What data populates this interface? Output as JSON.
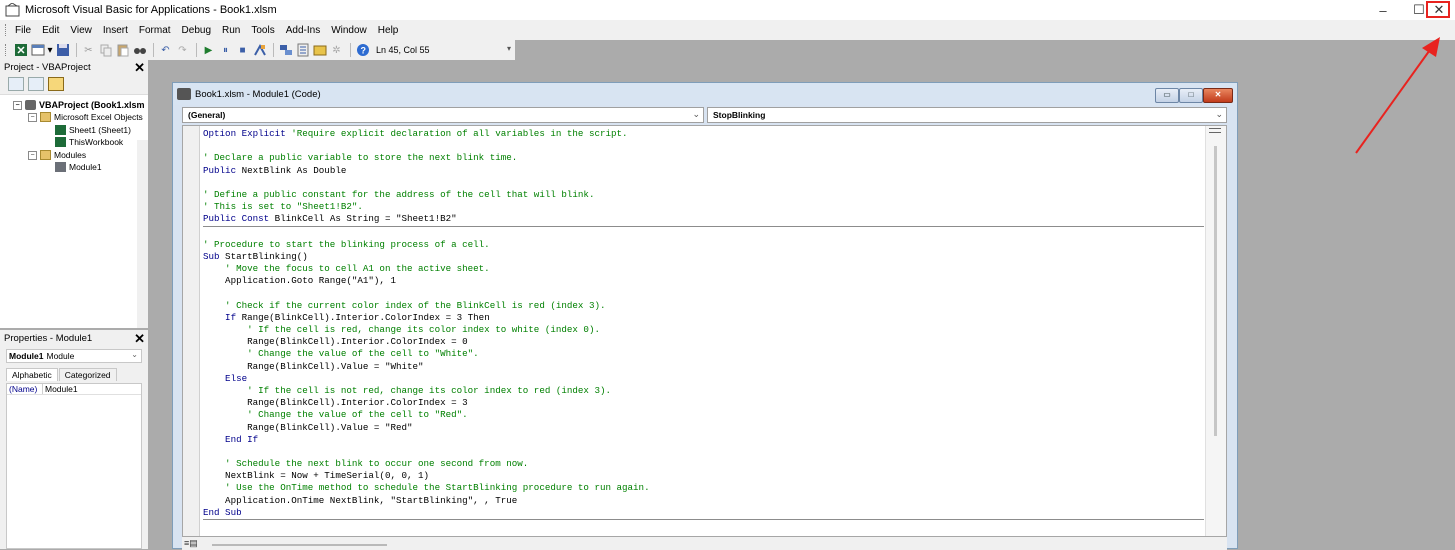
{
  "window": {
    "title": "Microsoft Visual Basic for Applications - Book1.xlsm",
    "minimize": "–",
    "maximize": "☐",
    "close": "✕"
  },
  "menu": {
    "items": [
      "File",
      "Edit",
      "View",
      "Insert",
      "Format",
      "Debug",
      "Run",
      "Tools",
      "Add-Ins",
      "Window",
      "Help"
    ]
  },
  "toolbar": {
    "position": "Ln 45, Col 55"
  },
  "project": {
    "title": "Project - VBAProject",
    "tree": {
      "root": "VBAProject (Book1.xlsm",
      "objects_folder": "Microsoft Excel Objects",
      "sheet1": "Sheet1 (Sheet1)",
      "workbook": "ThisWorkbook",
      "modules_folder": "Modules",
      "module1": "Module1"
    }
  },
  "properties": {
    "title": "Properties - Module1",
    "object_name": "Module1",
    "object_type": "Module",
    "tab_alphabetic": "Alphabetic",
    "tab_categorized": "Categorized",
    "prop_key": "(Name)",
    "prop_value": "Module1"
  },
  "code_window": {
    "title": "Book1.xlsm - Module1 (Code)",
    "object_combo": "(General)",
    "proc_combo": "StopBlinking",
    "btn_min": "▭",
    "btn_max": "□",
    "btn_close": "✕",
    "view_buttons": "≡▤",
    "lines": [
      {
        "kw": "Option Explicit",
        "cm": " 'Require explicit declaration of all variables in the script.",
        "tx": ""
      },
      {
        "kw": "",
        "cm": "",
        "tx": ""
      },
      {
        "kw": "",
        "cm": "' Declare a public variable to store the next blink time.",
        "tx": ""
      },
      {
        "kw": "Public",
        "cm": "",
        "tx": " NextBlink As Double"
      },
      {
        "kw": "",
        "cm": "",
        "tx": ""
      },
      {
        "kw": "",
        "cm": "' Define a public constant for the address of the cell that will blink.",
        "tx": ""
      },
      {
        "kw": "",
        "cm": "' This is set to \"Sheet1!B2\".",
        "tx": ""
      },
      {
        "kw": "Public Const",
        "cm": "",
        "tx": " BlinkCell As String = \"Sheet1!B2\"",
        "sep": true
      },
      {
        "kw": "",
        "cm": "",
        "tx": ""
      },
      {
        "kw": "",
        "cm": "' Procedure to start the blinking process of a cell.",
        "tx": ""
      },
      {
        "kw": "Sub",
        "cm": "",
        "tx": " StartBlinking()"
      },
      {
        "kw": "",
        "cm": "    ' Move the focus to cell A1 on the active sheet.",
        "tx": ""
      },
      {
        "kw": "",
        "cm": "",
        "tx": "    Application.Goto Range(\"A1\"), 1"
      },
      {
        "kw": "",
        "cm": "",
        "tx": ""
      },
      {
        "kw": "",
        "cm": "    ' Check if the current color index of the BlinkCell is red (index 3).",
        "tx": ""
      },
      {
        "kw": "    If",
        "cm": "",
        "tx": " Range(BlinkCell).Interior.ColorIndex = 3 Then"
      },
      {
        "kw": "",
        "cm": "        ' If the cell is red, change its color index to white (index 0).",
        "tx": ""
      },
      {
        "kw": "",
        "cm": "",
        "tx": "        Range(BlinkCell).Interior.ColorIndex = 0"
      },
      {
        "kw": "",
        "cm": "        ' Change the value of the cell to \"White\".",
        "tx": ""
      },
      {
        "kw": "",
        "cm": "",
        "tx": "        Range(BlinkCell).Value = \"White\""
      },
      {
        "kw": "    Else",
        "cm": "",
        "tx": ""
      },
      {
        "kw": "",
        "cm": "        ' If the cell is not red, change its color index to red (index 3).",
        "tx": ""
      },
      {
        "kw": "",
        "cm": "",
        "tx": "        Range(BlinkCell).Interior.ColorIndex = 3"
      },
      {
        "kw": "",
        "cm": "        ' Change the value of the cell to \"Red\".",
        "tx": ""
      },
      {
        "kw": "",
        "cm": "",
        "tx": "        Range(BlinkCell).Value = \"Red\""
      },
      {
        "kw": "    End If",
        "cm": "",
        "tx": ""
      },
      {
        "kw": "",
        "cm": "",
        "tx": ""
      },
      {
        "kw": "",
        "cm": "    ' Schedule the next blink to occur one second from now.",
        "tx": ""
      },
      {
        "kw": "",
        "cm": "",
        "tx": "    NextBlink = Now + TimeSerial(0, 0, 1)"
      },
      {
        "kw": "",
        "cm": "    ' Use the OnTime method to schedule the StartBlinking procedure to run again.",
        "tx": ""
      },
      {
        "kw": "",
        "cm": "",
        "tx": "    Application.OnTime NextBlink, \"StartBlinking\", , True"
      },
      {
        "kw": "End Sub",
        "cm": "",
        "tx": "",
        "sep": true
      }
    ]
  },
  "colors": {
    "keyword": "#00008b",
    "comment": "#008000",
    "annotation": "#e8231f"
  }
}
